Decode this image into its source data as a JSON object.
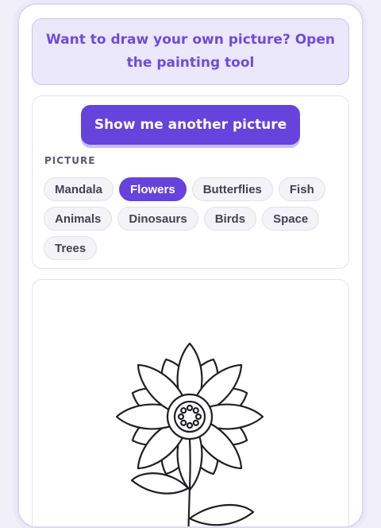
{
  "promo": {
    "text": "Want to draw your own picture? Open the painting tool"
  },
  "controls": {
    "next_button_label": "Show me another picture",
    "section_label": "PICTURE",
    "categories": [
      {
        "label": "Mandala",
        "selected": false
      },
      {
        "label": "Flowers",
        "selected": true
      },
      {
        "label": "Butterflies",
        "selected": false
      },
      {
        "label": "Fish",
        "selected": false
      },
      {
        "label": "Animals",
        "selected": false
      },
      {
        "label": "Dinosaurs",
        "selected": false
      },
      {
        "label": "Birds",
        "selected": false
      },
      {
        "label": "Space",
        "selected": false
      },
      {
        "label": "Trees",
        "selected": false
      }
    ]
  },
  "colors": {
    "accent": "#6543dc",
    "promo_bg": "#ebe8fb",
    "promo_text": "#6b4de0",
    "line_art": "#1f1f24"
  },
  "coloring_page": {
    "subject": "flower-outline"
  }
}
